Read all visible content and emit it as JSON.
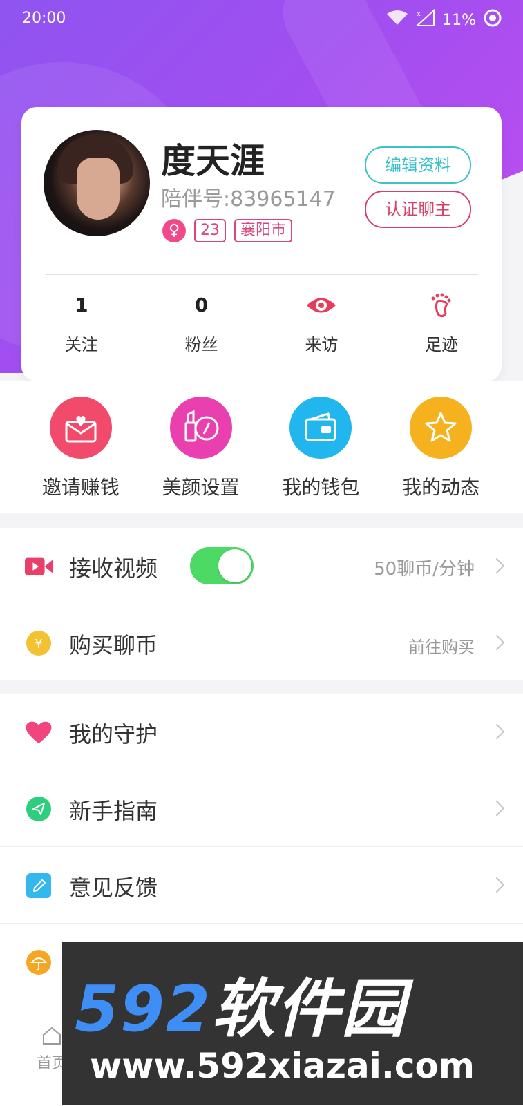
{
  "status_bar": {
    "time": "20:00",
    "battery": "11%"
  },
  "profile": {
    "name": "度天涯",
    "uid": "陪伴号:83965147",
    "gender_symbol": "♀",
    "age": "23",
    "city": "襄阳市",
    "edit_label": "编辑资料",
    "verify_label": "认证聊主"
  },
  "stats": [
    {
      "value": "1",
      "label": "关注"
    },
    {
      "value": "0",
      "label": "粉丝"
    },
    {
      "icon": "eye-icon",
      "label": "来访"
    },
    {
      "icon": "footprint-icon",
      "label": "足迹"
    }
  ],
  "quick_actions": [
    {
      "label": "邀请赚钱",
      "icon": "envelope-heart-icon",
      "color": "#f24a6a"
    },
    {
      "label": "美颜设置",
      "icon": "lipstick-icon",
      "color": "#ea3fae"
    },
    {
      "label": "我的钱包",
      "icon": "wallet-icon",
      "color": "#22b6ee"
    },
    {
      "label": "我的动态",
      "icon": "star-icon",
      "color": "#f6b21e"
    }
  ],
  "settings_group_1": {
    "receive_video": {
      "label": "接收视频",
      "value": "50聊币/分钟",
      "enabled": true
    },
    "buy_coins": {
      "label": "购买聊币",
      "value": "前往购买"
    }
  },
  "settings_group_2": [
    {
      "label": "我的守护",
      "icon": "heart-icon"
    },
    {
      "label": "新手指南",
      "icon": "send-icon"
    },
    {
      "label": "意见反馈",
      "icon": "pencil-icon"
    }
  ],
  "tabbar": {
    "home_label": "首页"
  },
  "watermark": {
    "brand_num": "592",
    "brand_cn": "软件园",
    "url": "www.592xiazai.com"
  }
}
